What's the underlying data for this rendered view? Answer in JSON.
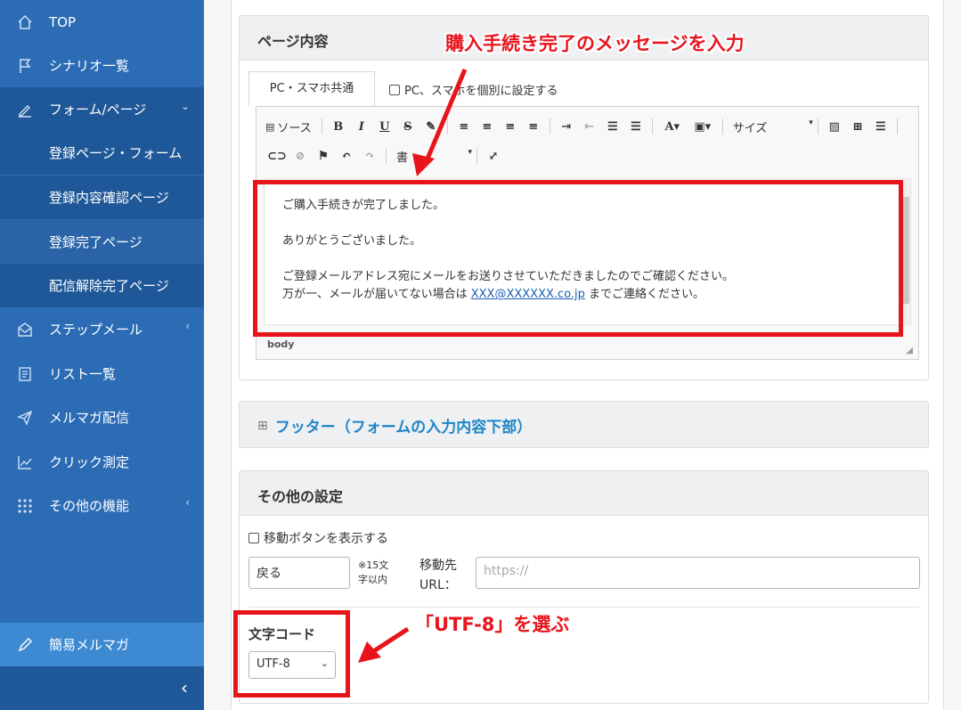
{
  "sidebar": {
    "items": [
      {
        "label": "TOP",
        "icon": "home-icon"
      },
      {
        "label": "シナリオ一覧",
        "icon": "flag-icon"
      },
      {
        "label": "フォーム/ページ",
        "icon": "pencil-icon"
      },
      {
        "label": "登録ページ・フォーム"
      },
      {
        "label": "登録内容確認ページ"
      },
      {
        "label": "登録完了ページ"
      },
      {
        "label": "配信解除完了ページ"
      },
      {
        "label": "ステップメール",
        "icon": "envelope-icon"
      },
      {
        "label": "リスト一覧",
        "icon": "list-icon"
      },
      {
        "label": "メルマガ配信",
        "icon": "paper-plane-icon"
      },
      {
        "label": "クリック測定",
        "icon": "chart-icon"
      },
      {
        "label": "その他の機能",
        "icon": "grid-icon"
      },
      {
        "label": "簡易メルマガ",
        "icon": "pen-icon"
      }
    ]
  },
  "page_content": {
    "title": "ページ内容",
    "tab_common": "PC・スマホ共通",
    "tab_separate": "PC、スマホを個別に設定する",
    "toolbar": {
      "source": "ソース",
      "bold": "B",
      "italic": "I",
      "underline": "U",
      "strike": "S",
      "size": "サイズ",
      "format": "書"
    },
    "content": {
      "line1": "ご購入手続きが完了しました。",
      "line2": "ありがとうございました。",
      "line3": "ご登録メールアドレス宛にメールをお送りさせていただきましたのでご確認ください。",
      "line4_prefix": "万が一、メールが届いてない場合は ",
      "line4_link": "XXX@XXXXXX.co.jp",
      "line4_suffix": " までご連絡ください。"
    },
    "status_path": "body"
  },
  "footer_section": {
    "expand_icon": "⊞",
    "title": "フッター（フォームの入力内容下部）"
  },
  "other_settings": {
    "title": "その他の設定",
    "move_button_label": "移動ボタンを表示する",
    "back_value": "戻る",
    "note_line1": "※15文",
    "note_line2": "字以内",
    "dest_label_line1": "移動先",
    "dest_label_line2": "URL：",
    "url_placeholder": "https://",
    "charset_label": "文字コード",
    "charset_value": "UTF-8"
  },
  "annotations": {
    "top": "購入手続き完了のメッセージを入力",
    "bottom": "「UTF-8」を選ぶ",
    "color": "#e8141c"
  }
}
